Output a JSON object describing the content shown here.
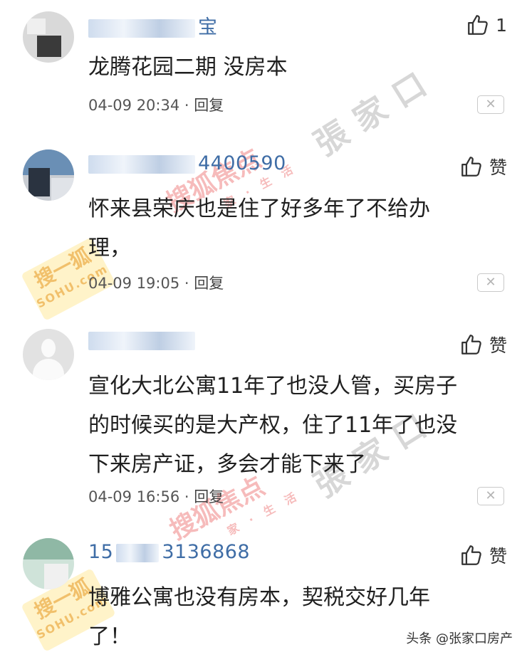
{
  "comments": [
    {
      "username_visible": "宝",
      "like_label": "1",
      "text": "龙腾花园二期 没房本",
      "date": "04-09 20:34",
      "reply_label": "回复"
    },
    {
      "username_visible": "4400590",
      "like_label": "赞",
      "text": "怀来县荣庆也是住了好多年了不给办\n理，",
      "date": "04-09 19:05",
      "reply_label": "回复"
    },
    {
      "username_visible": "",
      "like_label": "赞",
      "text": "宣化大北公寓11年了也没人管，买房子\n的时候买的是大产权，住了11年了也没\n下来房产证，多会才能下来了",
      "date": "04-09 16:56",
      "reply_label": "回复"
    },
    {
      "username_visible": "15",
      "username_visible_2": "3136868",
      "like_label": "赞",
      "text": "博雅公寓也没有房本，契税交好几年\n了！",
      "date": "",
      "reply_label": ""
    }
  ],
  "watermarks": {
    "site": "張家口",
    "sohu": "搜狐焦点",
    "sohu_sub": "家 · 生 活",
    "badge_main": "搜一狐",
    "badge_sub": "SOHU.com"
  },
  "footer": {
    "credit": "头条 @张家口房产"
  },
  "colors": {
    "username": "#3f6da6",
    "text": "#1f1f1f",
    "meta": "#555555"
  },
  "icons": {
    "like": "thumbs-up-icon",
    "close": "close-icon"
  }
}
